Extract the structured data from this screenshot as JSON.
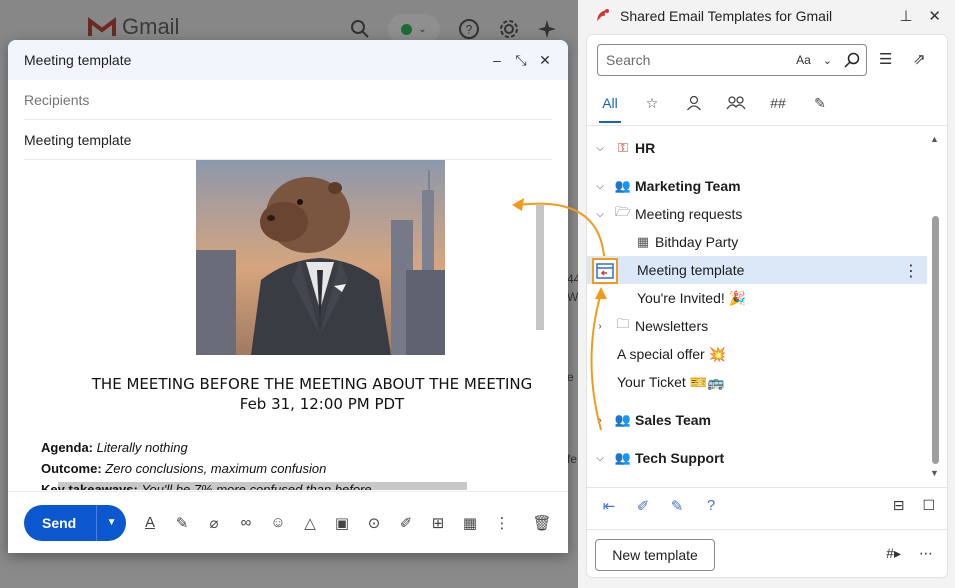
{
  "gmail": {
    "logo_text": "Gmail",
    "side_fragments": [
      "44",
      "W",
      "e",
      "fe"
    ]
  },
  "compose": {
    "title": "Meeting template",
    "recipients_placeholder": "Recipients",
    "subject": "Meeting template",
    "heading": "THE MEETING BEFORE THE MEETING ABOUT THE MEETING",
    "date": "Feb 31, 12:00 PM PDT",
    "agenda_label": "Agenda:",
    "agenda_value": "Literally nothing",
    "outcome_label": "Outcome:",
    "outcome_value": "Zero conclusions, maximum confusion",
    "takeaways_label": "Key takeaways:",
    "takeaways_value": "You'll be 7% more confused than before",
    "send_label": "Send"
  },
  "panel": {
    "title": "Shared Email Templates for Gmail",
    "search_placeholder": "Search",
    "match_case": "Aa",
    "tab_all": "All",
    "tree": [
      {
        "label": "HR",
        "bold": true,
        "expanded": true
      },
      {
        "label": "Marketing Team",
        "bold": true,
        "expanded": true
      },
      {
        "label": "Meeting requests",
        "bold": false,
        "expanded": true
      },
      {
        "label": "Bithday Party",
        "bold": false
      },
      {
        "label": "Meeting template",
        "bold": false,
        "selected": true
      },
      {
        "label": "You're Invited! 🎉",
        "bold": false
      },
      {
        "label": "Newsletters",
        "bold": false,
        "expanded": false
      },
      {
        "label": "A special offer 💥",
        "bold": false
      },
      {
        "label": "Your Ticket 🎫🚌",
        "bold": false
      },
      {
        "label": "Sales Team",
        "bold": true,
        "expanded": false
      },
      {
        "label": "Tech Support",
        "bold": true,
        "expanded": true
      }
    ],
    "new_template_label": "New template",
    "help": "?"
  },
  "colors": {
    "accent": "#0b57d0",
    "tab_active": "#1565c0",
    "selection": "#dbe8f8",
    "drag_arrow": "#f29a1a"
  }
}
